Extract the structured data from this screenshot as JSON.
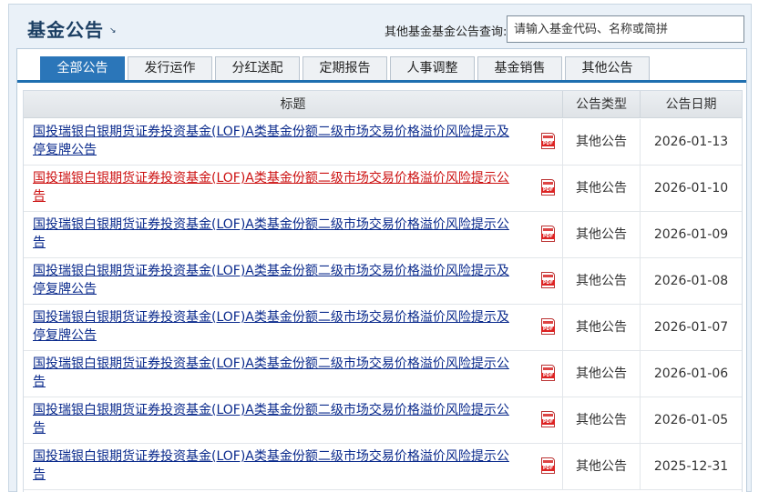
{
  "header": {
    "title": "基金公告",
    "search_label": "其他基金基金公告查询:",
    "search_placeholder": "请输入基金代码、名称或简拼"
  },
  "tabs": [
    {
      "label": "全部公告",
      "active": true
    },
    {
      "label": "发行运作",
      "active": false
    },
    {
      "label": "分红送配",
      "active": false
    },
    {
      "label": "定期报告",
      "active": false
    },
    {
      "label": "人事调整",
      "active": false
    },
    {
      "label": "基金销售",
      "active": false
    },
    {
      "label": "其他公告",
      "active": false
    }
  ],
  "table": {
    "columns": [
      "标题",
      "公告类型",
      "公告日期"
    ],
    "rows": [
      {
        "title": "国投瑞银白银期货证券投资基金(LOF)A类基金份额二级市场交易价格溢价风险提示及停复牌公告",
        "type": "其他公告",
        "date": "2026-01-13",
        "visited": false
      },
      {
        "title": "国投瑞银白银期货证券投资基金(LOF)A类基金份额二级市场交易价格溢价风险提示公告",
        "type": "其他公告",
        "date": "2026-01-10",
        "visited": true
      },
      {
        "title": "国投瑞银白银期货证券投资基金(LOF)A类基金份额二级市场交易价格溢价风险提示公告",
        "type": "其他公告",
        "date": "2026-01-09",
        "visited": false
      },
      {
        "title": "国投瑞银白银期货证券投资基金(LOF)A类基金份额二级市场交易价格溢价风险提示及停复牌公告",
        "type": "其他公告",
        "date": "2026-01-08",
        "visited": false
      },
      {
        "title": "国投瑞银白银期货证券投资基金(LOF)A类基金份额二级市场交易价格溢价风险提示及停复牌公告",
        "type": "其他公告",
        "date": "2026-01-07",
        "visited": false
      },
      {
        "title": "国投瑞银白银期货证券投资基金(LOF)A类基金份额二级市场交易价格溢价风险提示公告",
        "type": "其他公告",
        "date": "2026-01-06",
        "visited": false
      },
      {
        "title": "国投瑞银白银期货证券投资基金(LOF)A类基金份额二级市场交易价格溢价风险提示公告",
        "type": "其他公告",
        "date": "2026-01-05",
        "visited": false
      },
      {
        "title": "国投瑞银白银期货证券投资基金(LOF)A类基金份额二级市场交易价格溢价风险提示公告",
        "type": "其他公告",
        "date": "2025-12-31",
        "visited": false
      }
    ]
  },
  "icons": {
    "pdf": "pdf-icon",
    "title_arrow": "corner-arrow-icon"
  },
  "colors": {
    "accent": "#2b76b9",
    "link": "#0a2a8c",
    "visited_link": "#cc1111",
    "title": "#1c3f63"
  }
}
